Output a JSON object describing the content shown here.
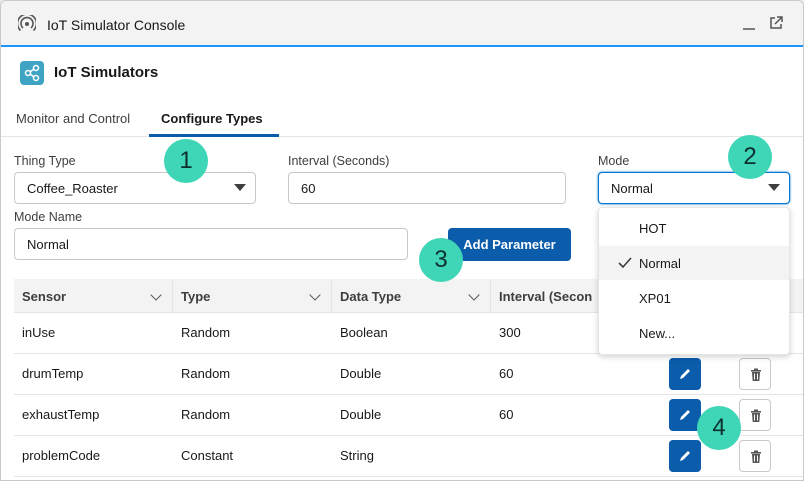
{
  "window": {
    "title": "IoT Simulator Console"
  },
  "app": {
    "title": "IoT Simulators"
  },
  "tabs": [
    {
      "label": "Monitor and Control"
    },
    {
      "label": "Configure Types"
    }
  ],
  "form": {
    "thing_type": {
      "label": "Thing Type",
      "value": "Coffee_Roaster"
    },
    "interval": {
      "label": "Interval (Seconds)",
      "value": "60"
    },
    "mode": {
      "label": "Mode",
      "value": "Normal"
    },
    "mode_name": {
      "label": "Mode Name",
      "value": "Normal"
    },
    "add_parameter_label": "Add Parameter"
  },
  "mode_options": [
    "HOT",
    "Normal",
    "XP01",
    "New..."
  ],
  "table": {
    "headers": [
      "Sensor",
      "Type",
      "Data Type",
      "Interval (Secon"
    ],
    "rows": [
      {
        "sensor": "inUse",
        "type": "Random",
        "data_type": "Boolean",
        "interval": "300"
      },
      {
        "sensor": "drumTemp",
        "type": "Random",
        "data_type": "Double",
        "interval": "60"
      },
      {
        "sensor": "exhaustTemp",
        "type": "Random",
        "data_type": "Double",
        "interval": "60"
      },
      {
        "sensor": "problemCode",
        "type": "Constant",
        "data_type": "String",
        "interval": ""
      }
    ]
  },
  "callouts": [
    "1",
    "2",
    "3",
    "4"
  ],
  "colors": {
    "brand": "#0b5cab",
    "accent": "#1b96ff",
    "callout": "#3ed6b6",
    "app_icon": "#3fa3c4"
  },
  "icons": {
    "window": "signal-icon",
    "minimize": "minimize-icon",
    "popout": "popout-icon",
    "app": "connected-devices-icon",
    "edit": "pencil-icon",
    "delete": "trash-icon",
    "selected": "check-icon"
  }
}
